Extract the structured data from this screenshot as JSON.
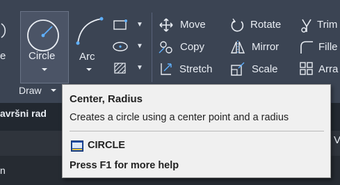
{
  "ribbon": {
    "partial_left": "e",
    "circle_label": "Circle",
    "arc_label": "Arc",
    "draw_panel_label": "Draw",
    "modify": {
      "move": "Move",
      "rotate": "Rotate",
      "trim": "Trim",
      "copy": "Copy",
      "mirror": "Mirror",
      "fillet": "Fille",
      "stretch": "Stretch",
      "scale": "Scale",
      "array": "Arra"
    }
  },
  "below": {
    "tab_partial": "avršni rad",
    "row_partial": "n",
    "right_partial": "V"
  },
  "tooltip": {
    "title": "Center, Radius",
    "description": "Creates a circle using a center point and a radius",
    "command": "CIRCLE",
    "help": "Press F1 for more help"
  },
  "colors": {
    "ribbon_bg": "#3b4453",
    "tooltip_bg": "#f0f0f0",
    "accent_icon": "#5fb0ff"
  },
  "icons": [
    "circle-center-radius-icon",
    "arc-icon",
    "rectangle-icon",
    "ellipse-icon",
    "hatch-icon",
    "move-icon",
    "rotate-icon",
    "trim-icon",
    "copy-icon",
    "mirror-icon",
    "fillet-icon",
    "stretch-icon",
    "scale-icon",
    "array-icon",
    "command-icon"
  ]
}
